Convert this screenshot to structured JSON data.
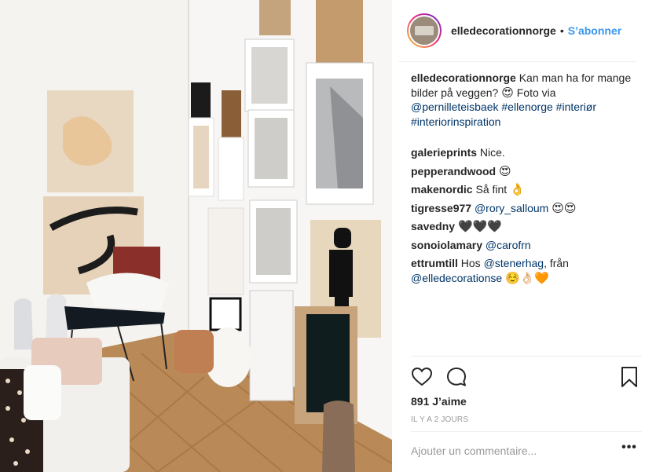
{
  "post": {
    "username": "elledecorationnorge",
    "separator": "•",
    "follow_label": "S’abonner",
    "photo_alt": "Interior with gallery wall of framed art, chair and herringbone floor"
  },
  "caption": {
    "user": "elledecorationnorge",
    "text": "Kan man ha for mange bilder på veggen?",
    "emoji": "😍",
    "text2": "Foto via",
    "tags": [
      "@pernilleteisbaek",
      "#ellenorge",
      "#interiør",
      "#interiorinspiration"
    ]
  },
  "comments": [
    {
      "user": "galerieprints",
      "text": "Nice."
    },
    {
      "user": "pepperandwood",
      "emoji": "😍"
    },
    {
      "user": "makenordic",
      "text": "Så fint",
      "emoji": "👌"
    },
    {
      "user": "tigresse977",
      "mention": "@rory_salloum",
      "emoji": "😍😍"
    },
    {
      "user": "savedny",
      "emoji": "🖤🖤🖤"
    },
    {
      "user": "sonoiolamary",
      "mention": "@carofrn"
    },
    {
      "user": "ettrumtill",
      "text": "Hos",
      "mention": "@stenerhag",
      "text2": ", från",
      "mention2": "@elledecorationse",
      "emoji": "☺️👌🏻🧡"
    }
  ],
  "actions": {
    "like_icon": "heart-icon",
    "comment_icon": "comment-bubble-icon",
    "save_icon": "bookmark-icon"
  },
  "likes": "891 J’aime",
  "timestamp": "IL Y A 2 JOURS",
  "comment_input": {
    "placeholder": "Ajouter un commentaire...",
    "value": ""
  },
  "more_label": "•••"
}
